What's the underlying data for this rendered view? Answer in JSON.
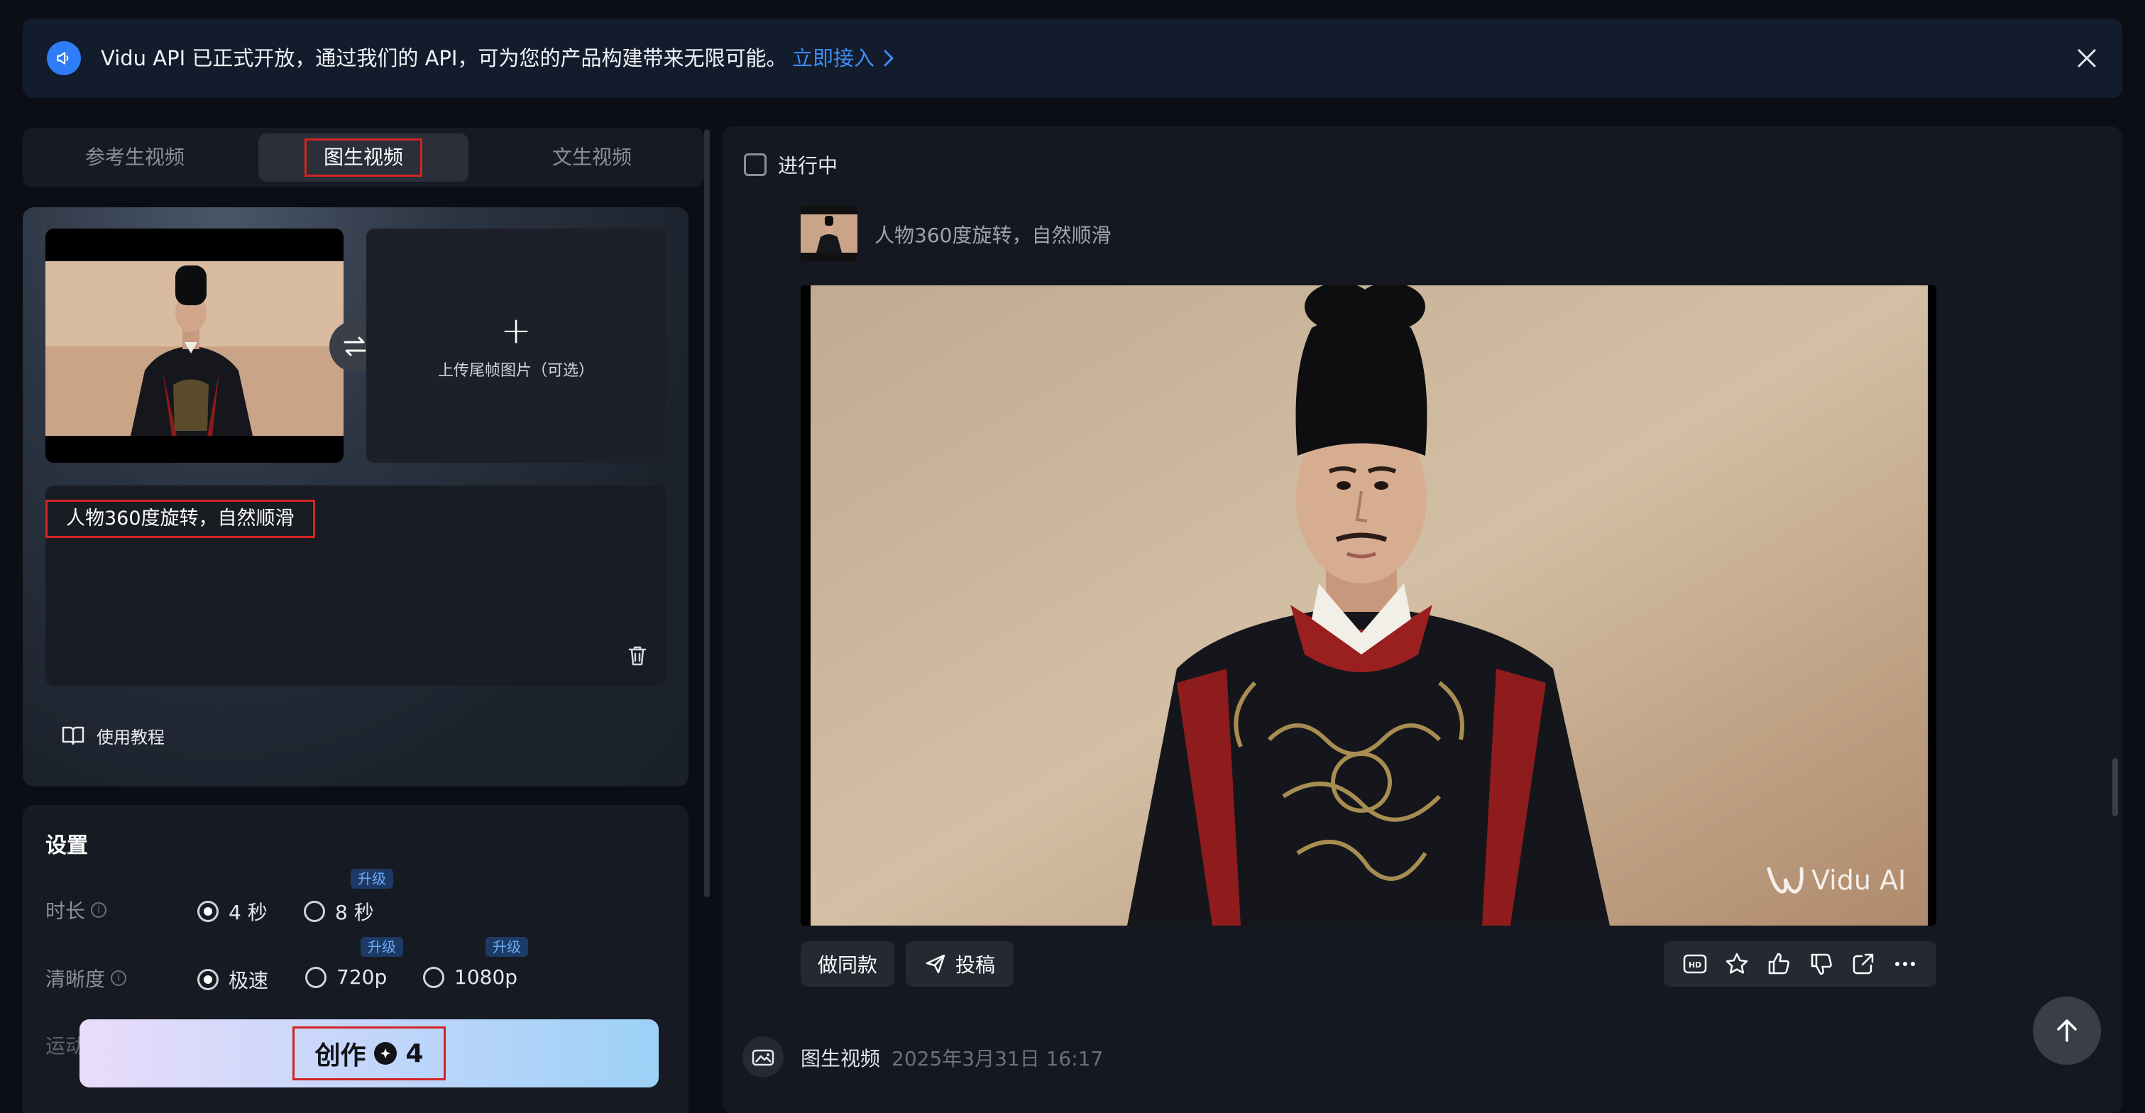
{
  "banner": {
    "text": "Vidu API 已正式开放，通过我们的 API，可为您的产品构建带来无限可能。",
    "link": "立即接入"
  },
  "tabs": [
    {
      "label": "参考生视频"
    },
    {
      "label": "图生视频"
    },
    {
      "label": "文生视频"
    }
  ],
  "upload": {
    "end_frame_label": "上传尾帧图片（可选）"
  },
  "prompt": {
    "text": "人物360度旋转，自然顺滑"
  },
  "tutorial": "使用教程",
  "settings": {
    "title": "设置",
    "duration": {
      "label": "时长",
      "options": [
        {
          "label": "4 秒",
          "selected": true,
          "badge": ""
        },
        {
          "label": "8 秒",
          "selected": false,
          "badge": "升级"
        }
      ]
    },
    "resolution": {
      "label": "清晰度",
      "options": [
        {
          "label": "极速",
          "selected": true,
          "badge": ""
        },
        {
          "label": "720p",
          "selected": false,
          "badge": "升级"
        },
        {
          "label": "1080p",
          "selected": false,
          "badge": "升级"
        }
      ]
    },
    "motion_label": "运动"
  },
  "create": {
    "label": "创作",
    "cost": "4"
  },
  "task": {
    "in_progress": "进行中",
    "prompt": "人物360度旋转，自然顺滑",
    "watermark": "Vidu AI",
    "actions": {
      "same_style": "做同款",
      "submit": "投稿"
    },
    "type": "图生视频",
    "date": "2025年3月31日 16:17"
  },
  "colors": {
    "accent": "#2e7df6",
    "link": "#3e8df7",
    "highlight_box": "#d22424"
  }
}
